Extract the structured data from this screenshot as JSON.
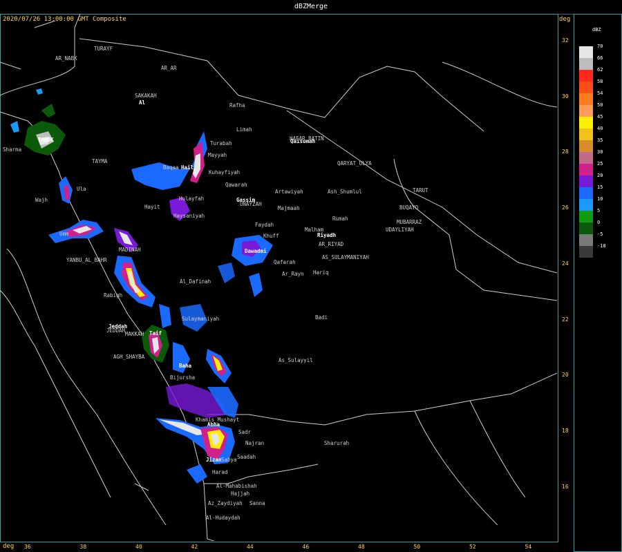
{
  "window": {
    "title": "dBZMerge"
  },
  "header": {
    "subtitle": "2020/07/26 13:00:00 GMT Composite",
    "unit_top_right": "deg"
  },
  "axes": {
    "x_unit": "deg",
    "y_unit": "deg",
    "x_ticks": [
      "36",
      "38",
      "40",
      "42",
      "44",
      "46",
      "48",
      "50",
      "52",
      "54"
    ],
    "y_ticks": [
      "32",
      "30",
      "28",
      "26",
      "24",
      "22",
      "20",
      "18",
      "16"
    ]
  },
  "legend": {
    "title": "dBZ",
    "entries": [
      {
        "value": "70",
        "color": "#e6e6e6"
      },
      {
        "value": "66",
        "color": "#bdbdbd"
      },
      {
        "value": "62",
        "color": "#ff2a1a"
      },
      {
        "value": "58",
        "color": "#ff4d1a"
      },
      {
        "value": "54",
        "color": "#ff7a1a"
      },
      {
        "value": "50",
        "color": "#ff9a5a"
      },
      {
        "value": "45",
        "color": "#ffee00"
      },
      {
        "value": "40",
        "color": "#f2c21a"
      },
      {
        "value": "35",
        "color": "#d98c2a"
      },
      {
        "value": "30",
        "color": "#c26a8a"
      },
      {
        "value": "25",
        "color": "#d0208c"
      },
      {
        "value": "20",
        "color": "#7a1ad9"
      },
      {
        "value": "15",
        "color": "#1a6aff"
      },
      {
        "value": "10",
        "color": "#1a9aff"
      },
      {
        "value": "5",
        "color": "#0f9a0f"
      },
      {
        "value": "0",
        "color": "#0a5a0a"
      },
      {
        "value": "-5",
        "color": "#7a7a7a"
      },
      {
        "value": "-10",
        "color": "#3a3a3a"
      }
    ]
  },
  "places": [
    {
      "name": "TURAYF"
    },
    {
      "name": "AR_NABK"
    },
    {
      "name": "AR_AR"
    },
    {
      "name": "SAKAKAH"
    },
    {
      "name": "Al"
    },
    {
      "name": "Rafha"
    },
    {
      "name": "Limah"
    },
    {
      "name": "HAFAR_BATIN"
    },
    {
      "name": "Qaisumah"
    },
    {
      "name": "Turabah"
    },
    {
      "name": "Mayyah"
    },
    {
      "name": "Sharma"
    },
    {
      "name": "TABUK"
    },
    {
      "name": "TAYMA"
    },
    {
      "name": "Hail"
    },
    {
      "name": "Kuhayfiyah"
    },
    {
      "name": "QARYAT_ULYA"
    },
    {
      "name": "Baqaa"
    },
    {
      "name": "Qawarah"
    },
    {
      "name": "Ula"
    },
    {
      "name": "Artawiyah"
    },
    {
      "name": "Ash_Shumlul"
    },
    {
      "name": "TARUT"
    },
    {
      "name": "Hulayfah"
    },
    {
      "name": "Gassim"
    },
    {
      "name": "UNAYZAH"
    },
    {
      "name": "Majmaah"
    },
    {
      "name": "BUQAYQ"
    },
    {
      "name": "Wajh"
    },
    {
      "name": "Hayit"
    },
    {
      "name": "Rumah"
    },
    {
      "name": "MUBARRAZ"
    },
    {
      "name": "Haysaniyah"
    },
    {
      "name": "UDAYLIYAH"
    },
    {
      "name": "Faydah"
    },
    {
      "name": "Malham"
    },
    {
      "name": "Umm"
    },
    {
      "name": "Khuff"
    },
    {
      "name": "Riyadh"
    },
    {
      "name": "AR_RIYAD"
    },
    {
      "name": "MADINAH"
    },
    {
      "name": "Dawadmi"
    },
    {
      "name": "YANBU_AL_BAHR"
    },
    {
      "name": "AS_SULAYMANIYAH"
    },
    {
      "name": "Qafarah"
    },
    {
      "name": "Ar_Rayn"
    },
    {
      "name": "Hariq"
    },
    {
      "name": "Al_Dafinah"
    },
    {
      "name": "Rabigh"
    },
    {
      "name": "Badi"
    },
    {
      "name": "Sulaymaniyah"
    },
    {
      "name": "Jeddah"
    },
    {
      "name": "JEDDAH"
    },
    {
      "name": "MAKKAH"
    },
    {
      "name": "Taif"
    },
    {
      "name": "AGH_SHAYBA"
    },
    {
      "name": "As_Sulayyil"
    },
    {
      "name": "Baha"
    },
    {
      "name": "Bijursha"
    },
    {
      "name": "Khamis_Mushayt"
    },
    {
      "name": "Abha"
    },
    {
      "name": "Sadr"
    },
    {
      "name": "Najran"
    },
    {
      "name": "Sharurah"
    },
    {
      "name": "Jizan"
    },
    {
      "name": "Sabya"
    },
    {
      "name": "Saadah"
    },
    {
      "name": "Harad"
    },
    {
      "name": "Al-Mahabishah"
    },
    {
      "name": "Hajjah"
    },
    {
      "name": "Sanna"
    },
    {
      "name": "Az_Zaydiyah"
    },
    {
      "name": "Al-Hudaydah"
    }
  ]
}
